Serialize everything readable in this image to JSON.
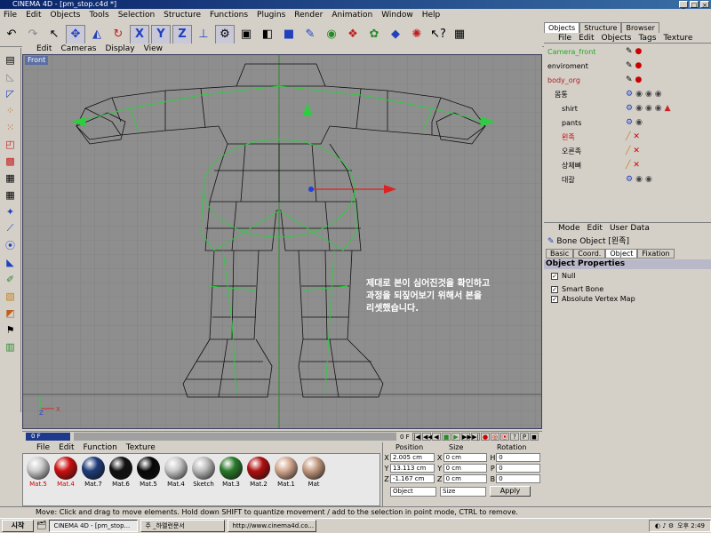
{
  "window": {
    "title": "CINEMA 4D - [pm_stop.c4d *]",
    "controls": [
      "_",
      "□",
      "×"
    ]
  },
  "menubar": [
    "File",
    "Edit",
    "Objects",
    "Tools",
    "Selection",
    "Structure",
    "Functions",
    "Plugins",
    "Render",
    "Animation",
    "Window",
    "Help"
  ],
  "toolbar": [
    "undo-icon",
    "redo-icon",
    "pointer-icon",
    "move-icon",
    "scale-icon",
    "rotate-icon",
    "x-axis-icon",
    "y-axis-icon",
    "z-axis-icon",
    "world-coord-icon",
    "model-mode-icon",
    "object-mode-icon",
    "edit-mode-icon",
    "cube-icon",
    "spline-icon",
    "nurbs-icon",
    "deformer-icon",
    "scene-icon",
    "light-icon",
    "camera-icon",
    "help-icon",
    "render-icon"
  ],
  "left_tools": [
    "window-icon",
    "polygon-icon",
    "edge-icon",
    "point-icon",
    "uv-icon",
    "texture-icon",
    "checker-icon",
    "checker2-icon",
    "checker3-icon",
    "bone-icon",
    "ik-icon",
    "joint-icon",
    "weight-icon",
    "paint-icon",
    "brush-icon",
    "map-icon",
    "tag-icon",
    "view-icon"
  ],
  "viewport": {
    "menu": [
      "Edit",
      "Cameras",
      "Display",
      "View"
    ],
    "label": "Front",
    "annotation": [
      "제대로 본이 심어진것을 확인하고",
      "과정을 되짚어보기 위해서 본을",
      "리셋했습니다."
    ]
  },
  "timeline": {
    "frame": "0 F",
    "end": "0 F",
    "transport": [
      "|◀",
      "◀◀",
      "◀",
      "■",
      "▶",
      "▶▶",
      "▶|",
      "●",
      "◎",
      "⦿",
      "?",
      "P",
      "◼"
    ]
  },
  "materials": {
    "menu": [
      "File",
      "Edit",
      "Function",
      "Texture"
    ],
    "items": [
      {
        "label": "Mat.5",
        "color": "#cccccc",
        "selected": true
      },
      {
        "label": "Mat.4",
        "color": "#cc1111",
        "selected": true
      },
      {
        "label": "Mat.7",
        "color": "#1f3c7a",
        "selected": false
      },
      {
        "label": "Mat.6",
        "color": "#111111",
        "selected": false
      },
      {
        "label": "Mat.5",
        "color": "#080808",
        "selected": false
      },
      {
        "label": "Mat.4",
        "color": "#c8c8c8",
        "selected": false
      },
      {
        "label": "Sketch",
        "color": "#bbbbbb",
        "selected": false
      },
      {
        "label": "Mat.3",
        "color": "#2a7a2a",
        "selected": false
      },
      {
        "label": "Mat.2",
        "color": "#b01010",
        "selected": false
      },
      {
        "label": "Mat.1",
        "color": "#d4a890",
        "selected": false
      },
      {
        "label": "Mat",
        "color": "#c49a80",
        "selected": false
      }
    ]
  },
  "coordinates": {
    "headers": [
      "Position",
      "Size",
      "Rotation"
    ],
    "rows": [
      {
        "axis": "X",
        "position": "2.005 cm",
        "size_axis": "X",
        "size": "0 cm",
        "rot_axis": "H",
        "rotation": "0"
      },
      {
        "axis": "Y",
        "position": "13.113 cm",
        "size_axis": "Y",
        "size": "0 cm",
        "rot_axis": "P",
        "rotation": "0"
      },
      {
        "axis": "Z",
        "position": "-1.167 cm",
        "size_axis": "Z",
        "size": "0 cm",
        "rot_axis": "B",
        "rotation": "0"
      }
    ],
    "mode_position": "Object",
    "mode_size": "Size",
    "apply": "Apply"
  },
  "right_panel": {
    "tabs": [
      "Objects",
      "Structure",
      "Browser"
    ],
    "menu": [
      "File",
      "Edit",
      "Objects",
      "Tags",
      "Texture"
    ],
    "objects": [
      {
        "name": "Camera_front",
        "indent": 0,
        "color": "#22aa22"
      },
      {
        "name": "enviroment",
        "indent": 0,
        "color": "#000000"
      },
      {
        "name": "body_org",
        "indent": 0,
        "color": "#aa2222"
      },
      {
        "name": "몸통",
        "indent": 1,
        "color": "#000000"
      },
      {
        "name": "shirt",
        "indent": 2,
        "color": "#000000"
      },
      {
        "name": "pants",
        "indent": 2,
        "color": "#000000"
      },
      {
        "name": "왼족",
        "indent": 2,
        "color": "#cc0000"
      },
      {
        "name": "오른족",
        "indent": 2,
        "color": "#000000"
      },
      {
        "name": "상체뼈",
        "indent": 2,
        "color": "#000000"
      },
      {
        "name": "대갈",
        "indent": 2,
        "color": "#000000"
      }
    ]
  },
  "attributes": {
    "menu": [
      "Mode",
      "Edit",
      "User Data"
    ],
    "title": "Bone Object [왼족]",
    "tabs": [
      "Basic",
      "Coord.",
      "Object",
      "Fixation"
    ],
    "active_tab": "Object",
    "section": "Object Properties",
    "checks": [
      {
        "label": "Null",
        "checked": true
      },
      {
        "label": "Smart Bone",
        "checked": true
      },
      {
        "label": "Absolute Vertex Map",
        "checked": true
      }
    ]
  },
  "statusbar": "Move: Click and drag to move elements. Hold down SHIFT to quantize movement / add to the selection in point mode, CTRL to remove.",
  "taskbar": {
    "start": "시작",
    "tasks": [
      "CINEMA 4D - [pm_stop...",
      "주 _하멜런문서",
      "http://www.cinema4d.co..."
    ],
    "clock": "오후 2:49"
  }
}
